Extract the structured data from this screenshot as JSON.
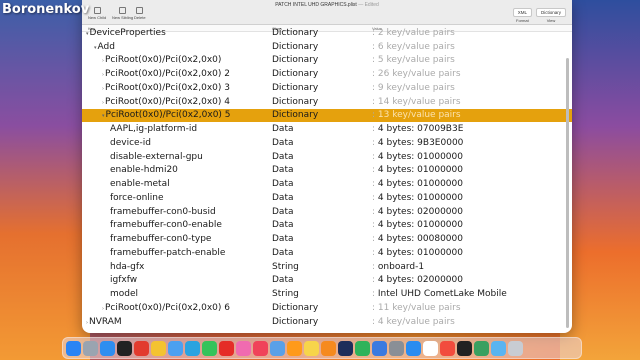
{
  "watermark": "Boronenkov",
  "window": {
    "title": "PATCH INTEL UHD GRAPHICS.plist",
    "edited": "— Edited"
  },
  "toolbar": {
    "new_child": "New Child",
    "new_sibling": "New Sibling",
    "delete": "Delete",
    "format_value": "XML",
    "format_label": "Format",
    "view_value": "Dictionary",
    "view_label": "View"
  },
  "columns": {
    "key": "Key",
    "class": "Class",
    "value": "Value"
  },
  "rows": [
    {
      "key": "DeviceProperties",
      "class": "Dictionary",
      "value": "2 key/value pairs",
      "muted": true
    },
    {
      "key": "Add",
      "class": "Dictionary",
      "value": "6 key/value pairs",
      "muted": true
    },
    {
      "key": "PciRoot(0x0)/Pci(0x2,0x0)",
      "class": "Dictionary",
      "value": "5 key/value pairs",
      "muted": true
    },
    {
      "key": "PciRoot(0x0)/Pci(0x2,0x0) 2",
      "class": "Dictionary",
      "value": "26 key/value pairs",
      "muted": true
    },
    {
      "key": "PciRoot(0x0)/Pci(0x2,0x0) 3",
      "class": "Dictionary",
      "value": "9 key/value pairs",
      "muted": true
    },
    {
      "key": "PciRoot(0x0)/Pci(0x2,0x0) 4",
      "class": "Dictionary",
      "value": "14 key/value pairs",
      "muted": true
    },
    {
      "key": "PciRoot(0x0)/Pci(0x2,0x0) 5",
      "class": "Dictionary",
      "value": "13 key/value pairs",
      "muted": true
    },
    {
      "key": "AAPL,ig-platform-id",
      "class": "Data",
      "value": "4 bytes: 07009B3E",
      "muted": false
    },
    {
      "key": "device-id",
      "class": "Data",
      "value": "4 bytes: 9B3E0000",
      "muted": false
    },
    {
      "key": "disable-external-gpu",
      "class": "Data",
      "value": "4 bytes: 01000000",
      "muted": false
    },
    {
      "key": "enable-hdmi20",
      "class": "Data",
      "value": "4 bytes: 01000000",
      "muted": false
    },
    {
      "key": "enable-metal",
      "class": "Data",
      "value": "4 bytes: 01000000",
      "muted": false
    },
    {
      "key": "force-online",
      "class": "Data",
      "value": "4 bytes: 01000000",
      "muted": false
    },
    {
      "key": "framebuffer-con0-busid",
      "class": "Data",
      "value": "4 bytes: 02000000",
      "muted": false
    },
    {
      "key": "framebuffer-con0-enable",
      "class": "Data",
      "value": "4 bytes: 01000000",
      "muted": false
    },
    {
      "key": "framebuffer-con0-type",
      "class": "Data",
      "value": "4 bytes: 00080000",
      "muted": false
    },
    {
      "key": "framebuffer-patch-enable",
      "class": "Data",
      "value": "4 bytes: 01000000",
      "muted": false
    },
    {
      "key": "hda-gfx",
      "class": "String",
      "value": "onboard-1",
      "muted": false
    },
    {
      "key": "igfxfw",
      "class": "Data",
      "value": "4 bytes: 02000000",
      "muted": false
    },
    {
      "key": "model",
      "class": "String",
      "value": "Intel UHD CometLake Mobile",
      "muted": false
    },
    {
      "key": "PciRoot(0x0)/Pci(0x2,0x0) 6",
      "class": "Dictionary",
      "value": "11 key/value pairs",
      "muted": true
    },
    {
      "key": "NVRAM",
      "class": "Dictionary",
      "value": "4 key/value pairs",
      "muted": true
    }
  ],
  "dock": {
    "icons": [
      "finder-icon",
      "launchpad-icon",
      "safari-icon",
      "terminal-icon",
      "yandex-icon",
      "chrome-icon",
      "mail-icon",
      "telegram-icon",
      "whatsapp-icon",
      "youtube-icon",
      "photos-icon",
      "music-icon",
      "preview-icon",
      "sublime-icon",
      "notes-icon",
      "pages-icon",
      "ps-icon",
      "numbers-icon",
      "keynote-icon",
      "system-settings-icon",
      "app-store-icon",
      "textedit-icon",
      "calendar-icon",
      "clock-icon",
      "activity-icon",
      "folder-icon",
      "trash-icon"
    ],
    "colors": [
      "#2a84f4",
      "#9aa4b0",
      "#2e8ef0",
      "#222222",
      "#e23b2e",
      "#f4c330",
      "#4ca0f0",
      "#2aa3e0",
      "#35c35a",
      "#e52d27",
      "#f06bb0",
      "#f0435a",
      "#5aa0e8",
      "#ff9a1a",
      "#f7d54a",
      "#f68a1e",
      "#1e2e5a",
      "#2fb35a",
      "#3a7ae0",
      "#8a8f96",
      "#2a8cf0",
      "#ffffff",
      "#f24c3d",
      "#222222",
      "#3aa060",
      "#5ab4f0",
      "#c8ccd2"
    ]
  }
}
